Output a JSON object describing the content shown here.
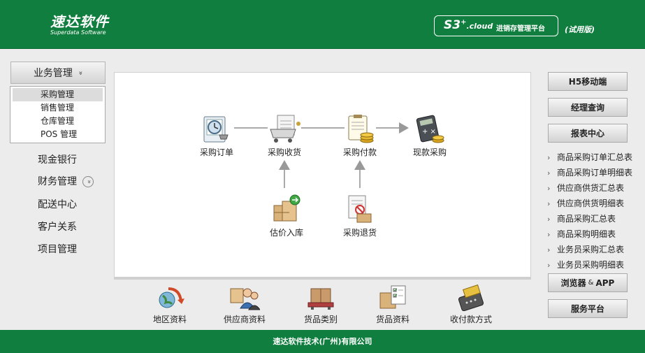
{
  "header": {
    "logo_main": "速达软件",
    "logo_sub": "Superdata Software",
    "product_s3": "S3",
    "product_plus": "+",
    "product_cloud": ".cloud",
    "platform": "进销存管理平台",
    "trial": "(试用版)"
  },
  "sidebar": {
    "business": "业务管理",
    "business_chevron": "»",
    "sub_items": [
      "采购管理",
      "销售管理",
      "仓库管理",
      "POS 管理"
    ],
    "cash_bank": "现金银行",
    "finance": "财务管理",
    "finance_chevron": "»",
    "delivery": "配送中心",
    "customer": "客户关系",
    "project": "项目管理"
  },
  "flow": {
    "purchase_order": "采购订单",
    "purchase_receive": "采购收货",
    "purchase_payment": "采购付款",
    "cash_purchase": "现款采购",
    "valuation_inbound": "估价入库",
    "purchase_return": "采购退货"
  },
  "basics": [
    "地区资料",
    "供应商资料",
    "货品类别",
    "货品资料",
    "收付款方式"
  ],
  "right": {
    "h5": "H5移动端",
    "manager_query": "经理查询",
    "report_center": "报表中心",
    "reports": [
      "商品采购订单汇总表",
      "商品采购订单明细表",
      "供应商供货汇总表",
      "供应商供货明细表",
      "商品采购汇总表",
      "商品采购明细表",
      "业务员采购汇总表",
      "业务员采购明细表"
    ],
    "report_chevron": "›",
    "browser": "浏览器",
    "amp": "&",
    "app": "APP",
    "service": "服务平台"
  },
  "footer": "速达软件技术(广州)有限公司",
  "colors": {
    "brand_green": "#107e3e",
    "panel_bg": "#ececec"
  }
}
